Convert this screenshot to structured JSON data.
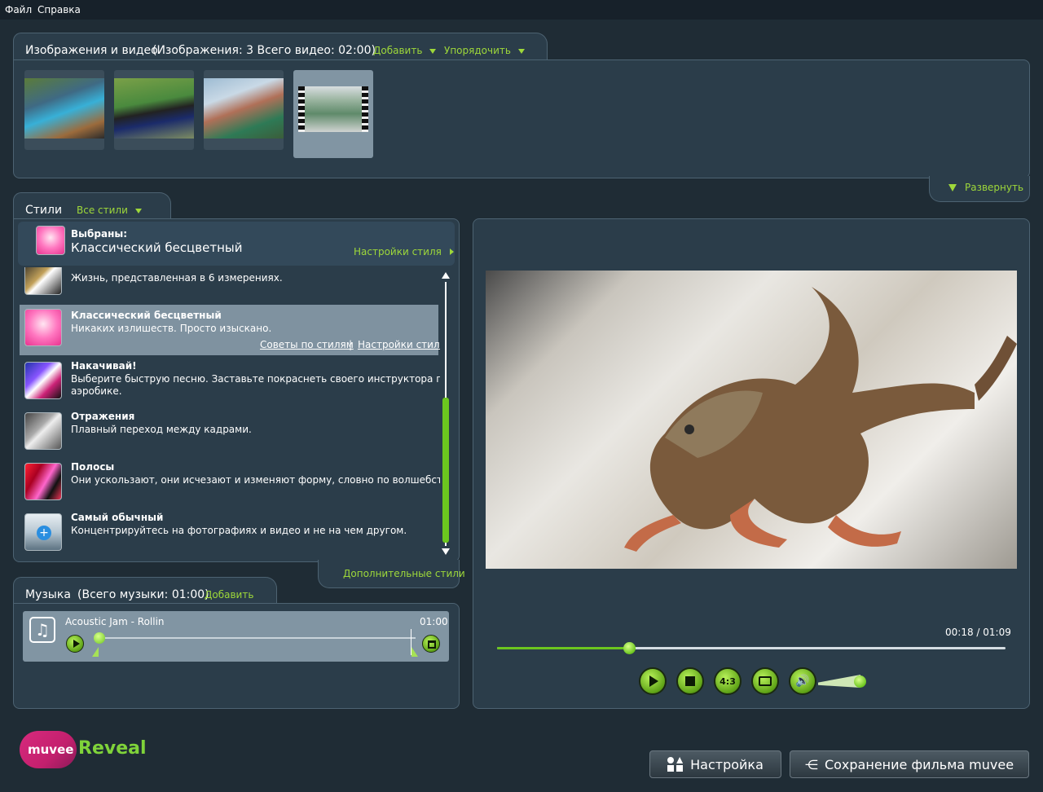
{
  "menu": {
    "file": "Файл",
    "help": "Справка"
  },
  "media": {
    "title": "Изображения и видео",
    "summary": "(Изображения: 3    Всего видео: 02:00)",
    "add": "Добавить",
    "arrange": "Упорядочить",
    "expand": "Развернуть"
  },
  "styles": {
    "title": "Стили",
    "all": "Все стили",
    "selected_label": "Выбраны:",
    "selected_name": "Классический бесцветный",
    "settings": "Настройки стиля",
    "more": "Дополнительные стили",
    "items": [
      {
        "name": "",
        "desc": "Жизнь, представленная в 6 измерениях."
      },
      {
        "name": "Классический бесцветный",
        "desc": "Никаких излишеств. Просто изыскано.",
        "tips": "Советы по стилям",
        "settings": "Настройки стиля"
      },
      {
        "name": "Накачивай!",
        "desc": "Выберите быструю песню. Заставьте покраснеть своего инструктора по",
        "desc2": "аэробике."
      },
      {
        "name": "Отражения",
        "desc": "Плавный переход между кадрами."
      },
      {
        "name": "Полосы",
        "desc": "Они ускользают, они исчезают и изменяют форму, словно по волшебству."
      },
      {
        "name": "Самый обычный",
        "desc": "Концентрируйтесь на фотографиях и видео и не на чем другом."
      }
    ]
  },
  "music": {
    "title": "Музыка",
    "summary": "(Всего музыки: 01:00)",
    "add": "Добавить",
    "track": "Acoustic Jam - Rollin",
    "duration": "01:00"
  },
  "preview": {
    "time": "00:18 / 01:09",
    "progress": 0.26,
    "aspect": "4:3"
  },
  "bottom": {
    "settings": "Настройка",
    "save": "Сохранение фильма muvee"
  },
  "logo": {
    "muvee": "muvee",
    "reveal": "Reveal"
  },
  "colors": {
    "accent": "#9ed83a",
    "panel": "#2b3d4a",
    "background": "#1f2c35"
  }
}
